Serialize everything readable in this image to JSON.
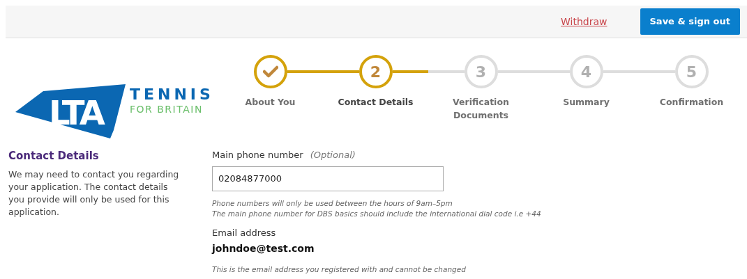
{
  "header": {
    "withdraw_link": "Withdraw",
    "save_button": "Save & sign out"
  },
  "logo": {
    "mark": "LTA",
    "line_1": "TENNIS",
    "line_2": "FOR BRITAIN"
  },
  "steps": [
    {
      "label": "About You",
      "completed": true,
      "selected": false
    },
    {
      "number": "2",
      "label": "Contact Details",
      "completed": false,
      "selected": true
    },
    {
      "number": "3",
      "label": "Verification Documents",
      "completed": false,
      "selected": false
    },
    {
      "number": "4",
      "label": "Summary",
      "completed": false,
      "selected": false
    },
    {
      "number": "5",
      "label": "Confirmation",
      "completed": false,
      "selected": false
    }
  ],
  "section": {
    "title": "Contact Details",
    "description": "We may need to contact you regarding your application. The contact details you provide will only be used for this application."
  },
  "phone": {
    "label": "Main phone number",
    "optional": "(Optional)",
    "value": "02084877000",
    "hints": [
      "Phone numbers will only be used between the hours of 9am–5pm",
      "The main phone number for DBS basics should include the international dial code i.e +44"
    ]
  },
  "email": {
    "label": "Email address",
    "value": "johndoe@test.com",
    "hint": "This is the email address you registered with and cannot be changed"
  }
}
